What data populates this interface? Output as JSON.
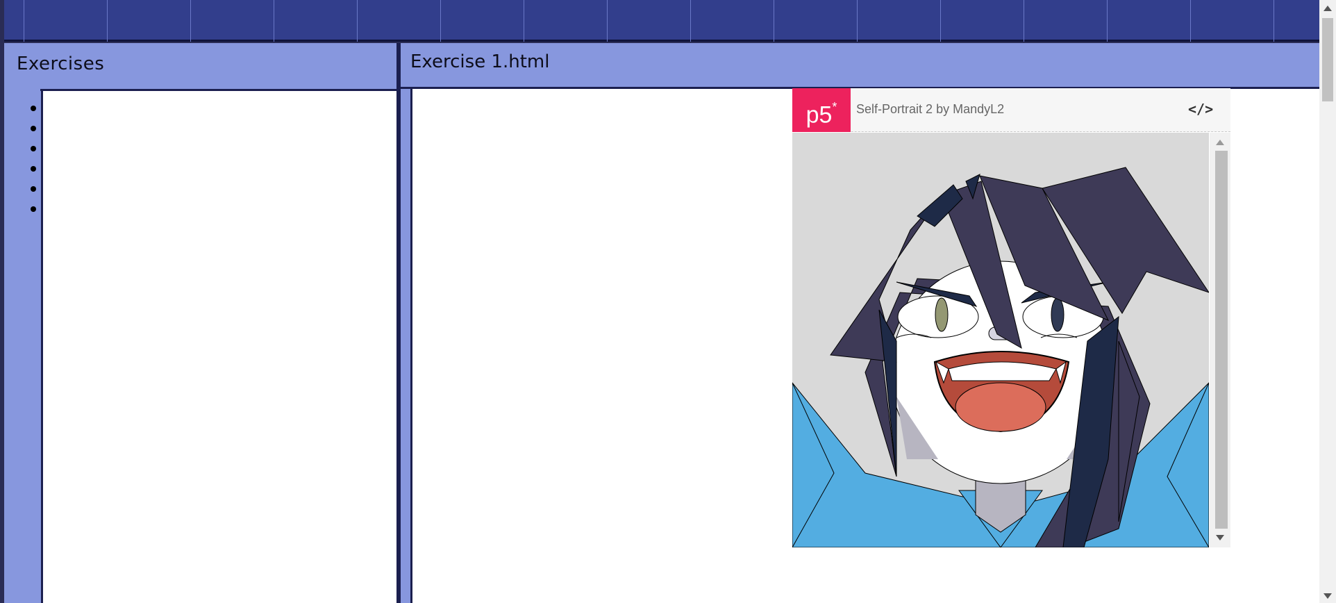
{
  "sidebar": {
    "title": "Exercises",
    "bullet_count": 6
  },
  "main": {
    "title": "Exercise 1.html"
  },
  "embed": {
    "logo": "p5",
    "logo_mark": "*",
    "sketch_title": "Self-Portrait 2",
    "by_label": "by",
    "author": "MandyL2",
    "code_icon": "</>"
  },
  "colors": {
    "nav_bg": "#323e8c",
    "panel_bg": "#8797de",
    "p5_pink": "#ed225d"
  }
}
